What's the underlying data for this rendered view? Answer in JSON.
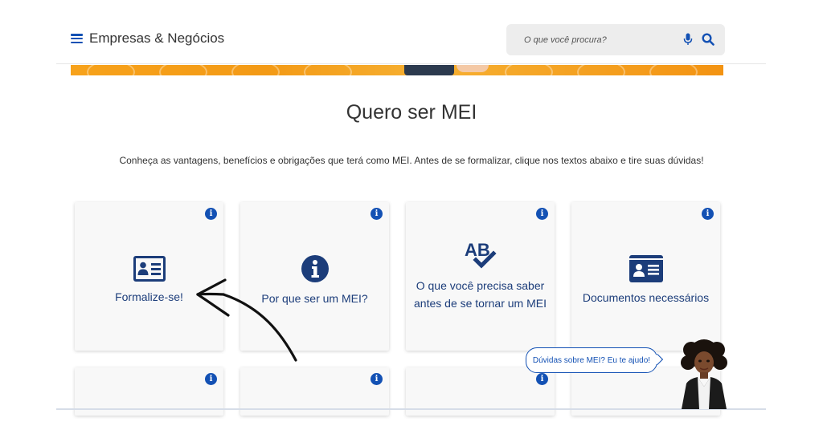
{
  "header": {
    "site_title": "Empresas & Negócios",
    "search_placeholder": "O que você procura?"
  },
  "main": {
    "title": "Quero ser MEI",
    "intro": "Conheça as vantagens, benefícios e obrigações que terá como MEI. Antes de se formalizar, clique nos textos abaixo e tire suas dúvidas!",
    "cards": [
      {
        "label": "Formalize-se!",
        "icon": "id-card-icon"
      },
      {
        "label": "Por que ser um MEI?",
        "icon": "info-circle-icon"
      },
      {
        "label": "O que você precisa saber antes de se tornar um MEI",
        "icon": "ab-check-icon"
      },
      {
        "label": "Documentos necessários",
        "icon": "document-card-icon"
      }
    ],
    "info_glyph": "i"
  },
  "assistant": {
    "bubble_text": "Dúvidas sobre MEI? Eu te ajudo!"
  },
  "colors": {
    "accent": "#1351b4",
    "card_text": "#1c3d7a",
    "icon_dark": "#1c3d7a",
    "banner": "#f39a16"
  }
}
